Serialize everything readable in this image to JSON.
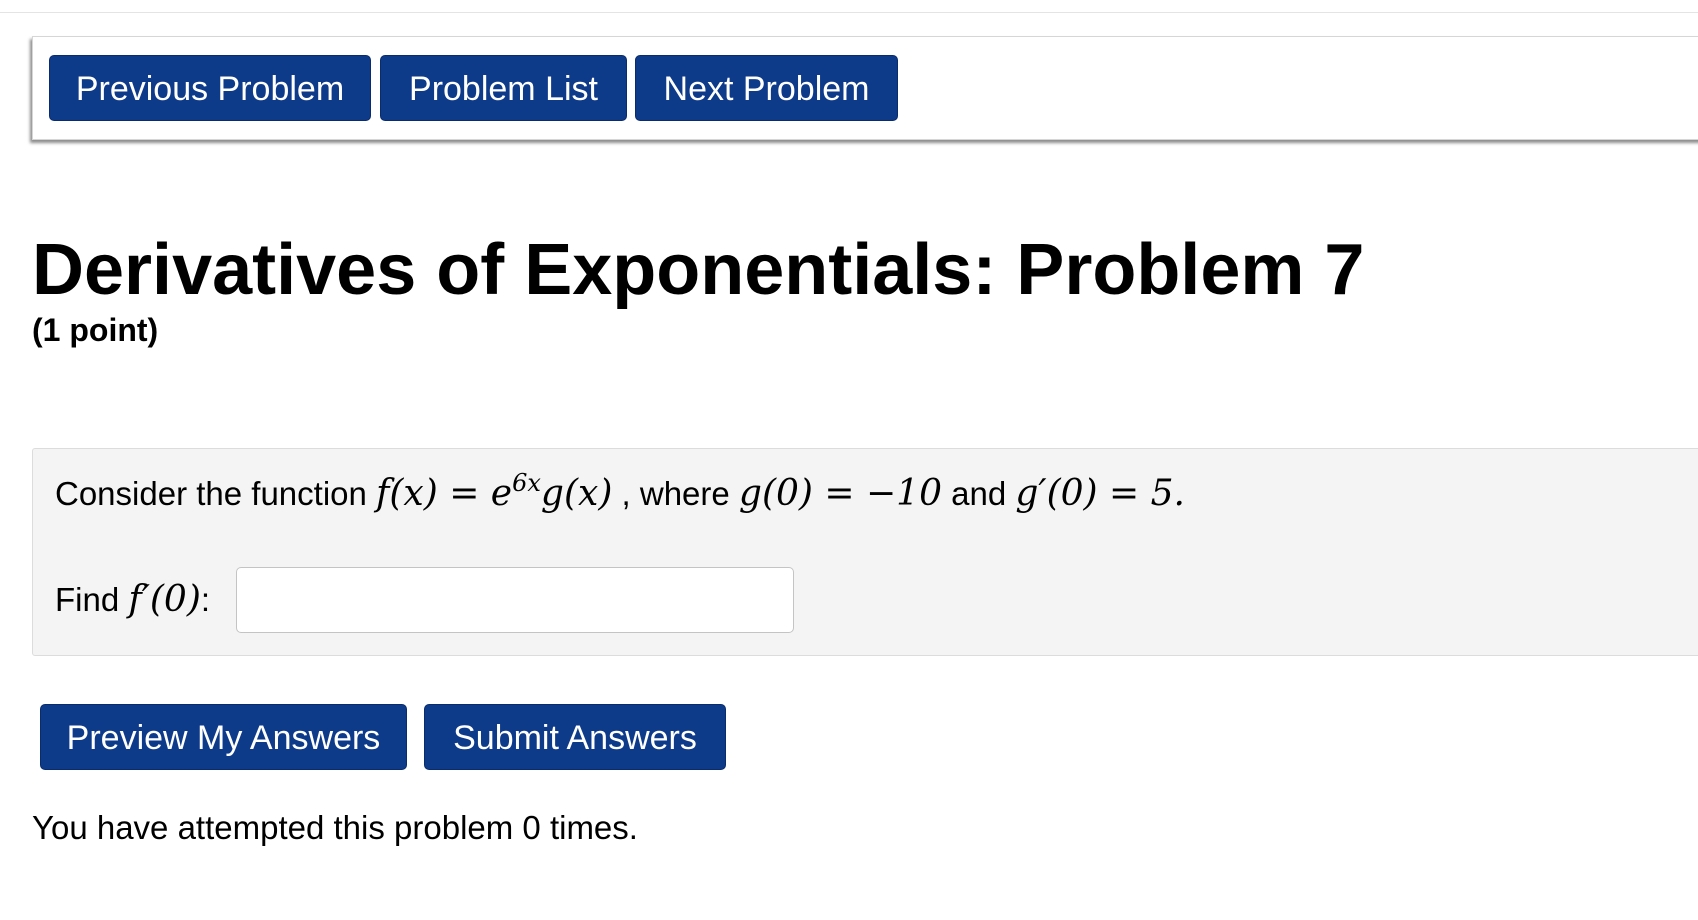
{
  "nav": {
    "previous_label": "Previous Problem",
    "list_label": "Problem List",
    "next_label": "Next Problem"
  },
  "problem": {
    "title": "Derivatives of Exponentials: Problem 7",
    "points": "(1 point)",
    "statement": {
      "prefix": "Consider the function",
      "f_def": "f(x) = e",
      "exponent": "6x",
      "g_of_x": "g(x)",
      "where": ", where",
      "g_value": "g(0) = −10",
      "and": "and",
      "gprime_value": "g′(0) = 5."
    },
    "find": {
      "label": "Find",
      "target": "f′(0)",
      "colon": ":"
    },
    "answer": {
      "value": "",
      "placeholder": ""
    }
  },
  "actions": {
    "preview_label": "Preview My Answers",
    "submit_label": "Submit Answers"
  },
  "status": {
    "attempts_text": "You have attempted this problem 0 times."
  },
  "colors": {
    "button_bg": "#0e3a8a",
    "panel_bg": "#f4f4f4"
  }
}
